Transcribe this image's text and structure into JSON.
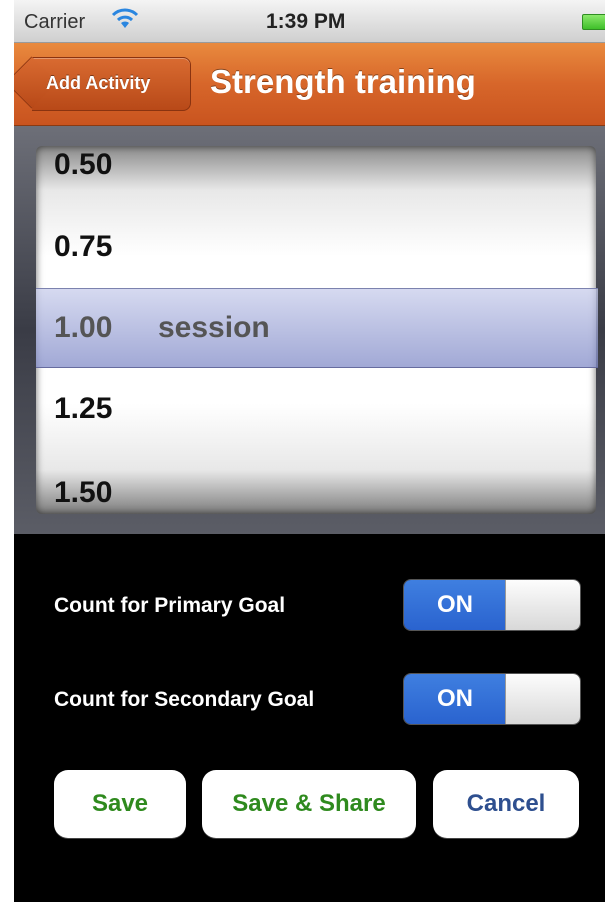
{
  "status_bar": {
    "carrier": "Carrier",
    "time": "1:39 PM",
    "wifi_icon": "wifi-icon",
    "battery_icon": "battery-icon"
  },
  "nav": {
    "back_label": "Add Activity",
    "title": "Strength training"
  },
  "picker": {
    "rows": [
      "0.50",
      "0.75",
      "1.25",
      "1.50"
    ],
    "selected_value": "1.00",
    "selected_unit": "session"
  },
  "settings": [
    {
      "label": "Count for Primary Goal",
      "state": "ON"
    },
    {
      "label": "Count for Secondary Goal",
      "state": "ON"
    }
  ],
  "buttons": {
    "save": "Save",
    "save_share": "Save & Share",
    "cancel": "Cancel"
  },
  "colors": {
    "nav_accent": "#d7662a",
    "switch_on": "#2a63cf",
    "save_text": "#2f8a1e",
    "cancel_text": "#2e4f8f"
  }
}
